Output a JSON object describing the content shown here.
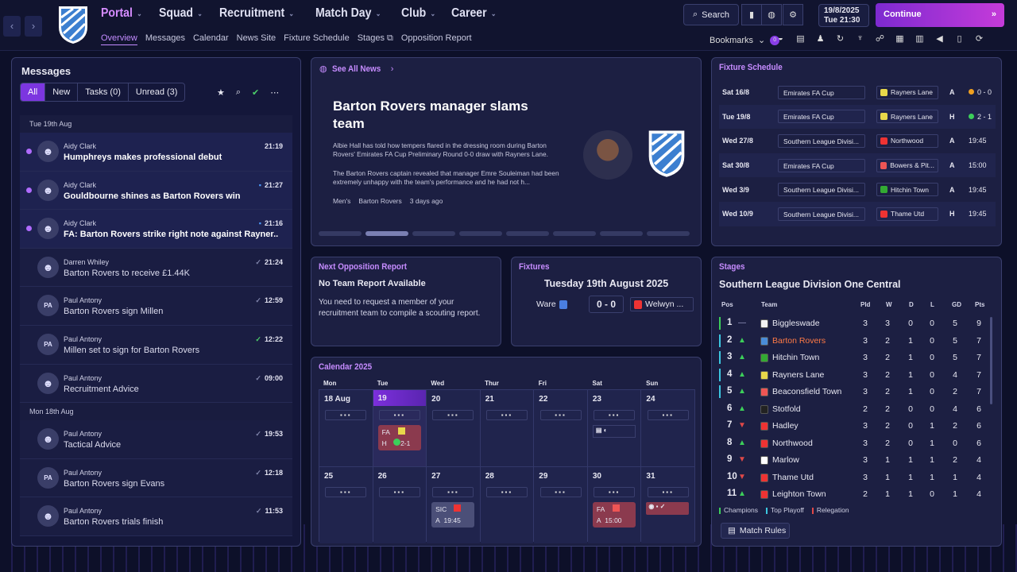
{
  "topbar": {
    "nav": [
      "Portal",
      "Squad",
      "Recruitment",
      "Match Day",
      "Club",
      "Career"
    ],
    "subnav": [
      "Overview",
      "Messages",
      "Calendar",
      "News Site",
      "Fixture Schedule",
      "Stages",
      "Opposition Report"
    ],
    "search_label": "Search",
    "date": "19/8/2025",
    "day_time": "Tue  21:30",
    "continue_label": "Continue",
    "bookmarks_label": "Bookmarks",
    "bookmarks_badge": "0"
  },
  "messages": {
    "title": "Messages",
    "filters": [
      "All",
      "New",
      "Tasks (0)",
      "Unread (3)"
    ],
    "day1": "Tue 19th Aug",
    "day2": "Mon 18th Aug",
    "items": [
      {
        "from": "Aidy Clark",
        "subject": "Humphreys makes professional debut",
        "time": "21:19",
        "unread": true,
        "avatar": "",
        "mark": ""
      },
      {
        "from": "Aidy Clark",
        "subject": "Gouldbourne shines as Barton Rovers win",
        "time": "21:27",
        "unread": true,
        "avatar": "",
        "mark": "chat"
      },
      {
        "from": "Aidy Clark",
        "subject": "FA: Barton Rovers strike right note against Rayner...",
        "time": "21:16",
        "unread": true,
        "avatar": "",
        "mark": "chat"
      },
      {
        "from": "Darren Whiley",
        "subject": "Barton Rovers to receive £1.44K",
        "time": "21:24",
        "unread": false,
        "avatar": "",
        "mark": "tick"
      },
      {
        "from": "Paul Antony",
        "subject": "Barton Rovers sign Millen",
        "time": "12:59",
        "unread": false,
        "avatar": "PA",
        "mark": "tick"
      },
      {
        "from": "Paul Antony",
        "subject": "Millen set to sign for Barton Rovers",
        "time": "12:22",
        "unread": false,
        "avatar": "PA",
        "mark": "tickg"
      },
      {
        "from": "Paul Antony",
        "subject": "Recruitment Advice",
        "time": "09:00",
        "unread": false,
        "avatar": "",
        "mark": "tick"
      },
      {
        "from": "Paul Antony",
        "subject": "Tactical Advice",
        "time": "19:53",
        "unread": false,
        "avatar": "",
        "mark": "tick"
      },
      {
        "from": "Paul Antony",
        "subject": "Barton Rovers sign Evans",
        "time": "12:18",
        "unread": false,
        "avatar": "PA",
        "mark": "tick"
      },
      {
        "from": "Paul Antony",
        "subject": "Barton Rovers trials finish",
        "time": "11:53",
        "unread": false,
        "avatar": "",
        "mark": "tick"
      }
    ]
  },
  "news": {
    "link": "See All News",
    "headline": "Barton Rovers manager slams team",
    "p1": "Albie Hall has told how tempers flared in the dressing room during Barton Rovers' Emirates FA Cup Preliminary Round 0-0 draw with Rayners Lane.",
    "p2": "The Barton Rovers captain revealed that manager Emre Souleiman had been extremely unhappy with the team's performance and he had not h...",
    "tag1": "Men's",
    "tag2": "Barton Rovers",
    "ago": "3 days ago"
  },
  "fixture_schedule": {
    "title": "Fixture Schedule",
    "rows": [
      {
        "date": "Sat 16/8",
        "comp": "Emirates FA Cup",
        "team": "Rayners Lane",
        "ha": "A",
        "res": "0 - 0",
        "dot": "#f0a020",
        "tc": "#e8d84a"
      },
      {
        "date": "Tue 19/8",
        "comp": "Emirates FA Cup",
        "team": "Rayners Lane",
        "ha": "H",
        "res": "2 - 1",
        "dot": "#3ccf5a",
        "tc": "#e8d84a"
      },
      {
        "date": "Wed 27/8",
        "comp": "Southern League Divisi...",
        "team": "Northwood",
        "ha": "A",
        "res": "19:45",
        "dot": "",
        "tc": "#e33"
      },
      {
        "date": "Sat 30/8",
        "comp": "Emirates FA Cup",
        "team": "Bowers & Pit...",
        "ha": "A",
        "res": "15:00",
        "dot": "",
        "tc": "#e55"
      },
      {
        "date": "Wed 3/9",
        "comp": "Southern League Divisi...",
        "team": "Hitchin Town",
        "ha": "A",
        "res": "19:45",
        "dot": "",
        "tc": "#3a3"
      },
      {
        "date": "Wed 10/9",
        "comp": "Southern League Divisi...",
        "team": "Thame Utd",
        "ha": "H",
        "res": "19:45",
        "dot": "",
        "tc": "#e33"
      }
    ]
  },
  "opposition": {
    "title": "Next Opposition Report",
    "status": "No Team Report Available",
    "desc": "You need to request a member of your recruitment team to compile a scouting report."
  },
  "fixtures": {
    "title": "Fixtures",
    "date": "Tuesday 19th August 2025",
    "home": "Ware",
    "score": "0 - 0",
    "away": "Welwyn ..."
  },
  "calendar": {
    "title": "Calendar 2025",
    "dows": [
      "Mon",
      "Tue",
      "Wed",
      "Thur",
      "Fri",
      "Sat",
      "Sun"
    ],
    "days": [
      "18 Aug",
      "19",
      "20",
      "21",
      "22",
      "23",
      "24",
      "25",
      "26",
      "27",
      "28",
      "29",
      "30",
      "31"
    ],
    "icons": [
      "▪▪▪",
      "▪▪▪",
      "▪▪▪",
      "▪▪▪",
      "▪▪▪",
      "▪▪▪",
      "▪▪▪",
      "▪▪▪",
      "▪▪▪",
      "▪▪▪",
      "▪▪▪",
      "▪▪▪",
      "▪▪▪",
      "▪▪▪"
    ],
    "m1_comp": "FA",
    "m1_ha": "H",
    "m1_res": "2-1",
    "m2_comp": "SIC",
    "m2_ha": "A",
    "m2_time": "19:45",
    "m3_comp": "FA",
    "m3_ha": "A",
    "m3_time": "15:00"
  },
  "stages": {
    "title": "Stages",
    "league": "Southern League Division One Central",
    "headers": [
      "Pos",
      "Team",
      "Pld",
      "W",
      "D",
      "L",
      "GD",
      "Pts"
    ],
    "rows": [
      {
        "pos": "1",
        "arrow": "—",
        "team": "Biggleswade",
        "pld": "3",
        "w": "3",
        "d": "0",
        "l": "0",
        "gd": "5",
        "pts": "9",
        "bar": "#3ccf5a",
        "c": "#f2f2f2",
        "ac": "#9a9fc8"
      },
      {
        "pos": "2",
        "arrow": "▲",
        "team": "Barton Rovers",
        "pld": "3",
        "w": "2",
        "d": "1",
        "l": "0",
        "gd": "5",
        "pts": "7",
        "bar": "#3bc7e0",
        "c": "#4a8dd8",
        "ac": "#3ccf5a"
      },
      {
        "pos": "3",
        "arrow": "▲",
        "team": "Hitchin Town",
        "pld": "3",
        "w": "2",
        "d": "1",
        "l": "0",
        "gd": "5",
        "pts": "7",
        "bar": "#3bc7e0",
        "c": "#3a3",
        "ac": "#3ccf5a"
      },
      {
        "pos": "4",
        "arrow": "▲",
        "team": "Rayners Lane",
        "pld": "3",
        "w": "2",
        "d": "1",
        "l": "0",
        "gd": "4",
        "pts": "7",
        "bar": "#3bc7e0",
        "c": "#e8d84a",
        "ac": "#3ccf5a"
      },
      {
        "pos": "5",
        "arrow": "▲",
        "team": "Beaconsfield Town",
        "pld": "3",
        "w": "2",
        "d": "1",
        "l": "0",
        "gd": "2",
        "pts": "7",
        "bar": "#3bc7e0",
        "c": "#e55",
        "ac": "#3ccf5a"
      },
      {
        "pos": "6",
        "arrow": "▲",
        "team": "Stotfold",
        "pld": "2",
        "w": "2",
        "d": "0",
        "l": "0",
        "gd": "4",
        "pts": "6",
        "bar": "",
        "c": "#222",
        "ac": "#3ccf5a"
      },
      {
        "pos": "7",
        "arrow": "▼",
        "team": "Hadley",
        "pld": "3",
        "w": "2",
        "d": "0",
        "l": "1",
        "gd": "2",
        "pts": "6",
        "bar": "",
        "c": "#e33",
        "ac": "#e04848"
      },
      {
        "pos": "8",
        "arrow": "▲",
        "team": "Northwood",
        "pld": "3",
        "w": "2",
        "d": "0",
        "l": "1",
        "gd": "0",
        "pts": "6",
        "bar": "",
        "c": "#e33",
        "ac": "#3ccf5a"
      },
      {
        "pos": "9",
        "arrow": "▼",
        "team": "Marlow",
        "pld": "3",
        "w": "1",
        "d": "1",
        "l": "1",
        "gd": "2",
        "pts": "4",
        "bar": "",
        "c": "#fff",
        "ac": "#e04848"
      },
      {
        "pos": "10",
        "arrow": "▼",
        "team": "Thame Utd",
        "pld": "3",
        "w": "1",
        "d": "1",
        "l": "1",
        "gd": "1",
        "pts": "4",
        "bar": "",
        "c": "#e33",
        "ac": "#e04848"
      },
      {
        "pos": "11",
        "arrow": "▲",
        "team": "Leighton Town",
        "pld": "2",
        "w": "1",
        "d": "1",
        "l": "0",
        "gd": "1",
        "pts": "4",
        "bar": "",
        "c": "#e33",
        "ac": "#3ccf5a"
      }
    ],
    "legend": [
      "Champions",
      "Top Playoff",
      "Relegation"
    ],
    "rules": "Match Rules"
  },
  "colors": {
    "accent": "#c68cff",
    "bg": "#0d1029",
    "panel": "#1c1f42"
  }
}
